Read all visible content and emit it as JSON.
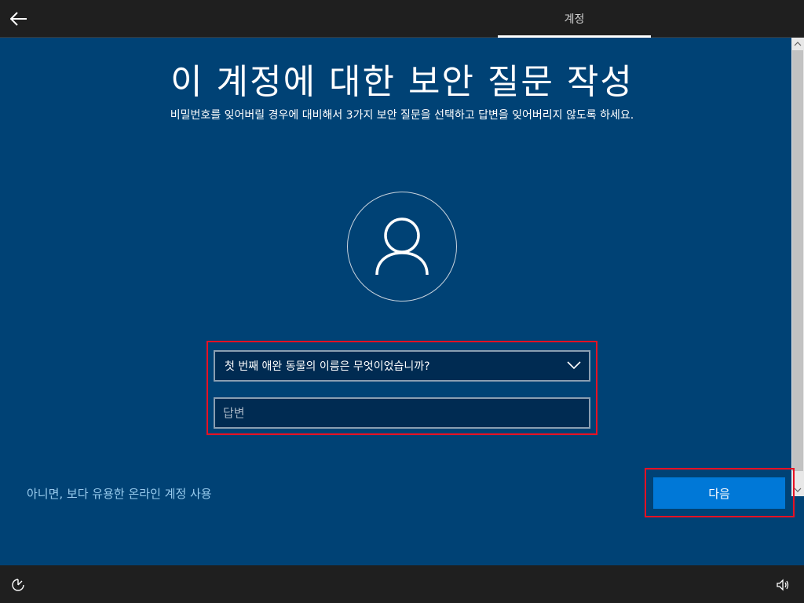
{
  "header": {
    "tab_label": "계정"
  },
  "page": {
    "title": "이 계정에 대한 보안 질문 작성",
    "subtitle": "비밀번호를 잊어버릴 경우에 대비해서 3가지 보안 질문을 선택하고 답변을 잊어버리지 않도록 하세요."
  },
  "form": {
    "question_selected": "첫 번째 애완 동물의 이름은 무엇이었습니까?",
    "answer_value": "",
    "answer_placeholder": "답변"
  },
  "footer": {
    "online_link_label": "아니면, 보다 유용한 온라인 계정 사용",
    "next_label": "다음"
  },
  "icons": {
    "back": "back-arrow-icon",
    "avatar": "user-icon",
    "dropdown": "chevron-down-icon",
    "ease_of_access": "ease-of-access-icon",
    "volume": "volume-icon"
  },
  "colors": {
    "background": "#004275",
    "accent": "#0078d7",
    "link": "#99ccee",
    "highlight": "#e81123"
  }
}
